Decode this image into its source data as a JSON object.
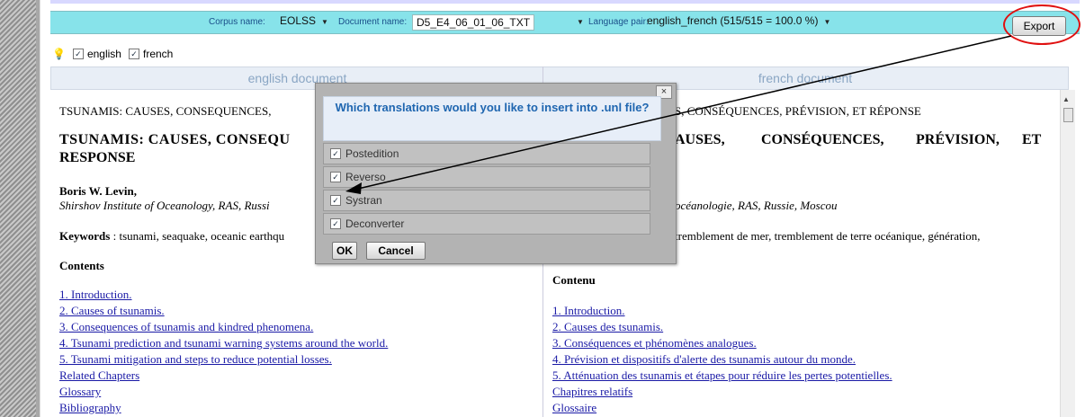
{
  "toolbar": {
    "corpus_label": "Corpus name:",
    "corpus_value": "EOLSS",
    "document_label": "Document name:",
    "document_value": "D5_E4_06_01_06_TXT",
    "language_label": "Language pair:",
    "language_value": "english_french (515/515 = 100.0 %)",
    "export_label": "Export"
  },
  "languages": {
    "english": "english",
    "french": "french"
  },
  "columns": {
    "left_header": "english document",
    "right_header": "french document"
  },
  "english_doc": {
    "title_line": "TSUNAMIS: CAUSES, CONSEQUENCES,",
    "heading_1": "TSUNAMIS: CAUSES, CONSEQU",
    "heading_2": "RESPONSE",
    "author": "Boris W. Levin,",
    "affiliation": "Shirshov Institute of Oceanology, RAS, Russi",
    "keywords_label": "Keywords",
    "keywords_text": ": tsunami, seaquake, oceanic earthqu",
    "contents_heading": "Contents",
    "toc": [
      "1. Introduction.",
      "2. Causes of tsunamis.",
      "3. Consequences of tsunamis and kindred phenomena.",
      "4. Tsunami prediction and tsunami warning systems around the world.",
      "5. Tsunami mitigation and steps to reduce potential losses.",
      "Related Chapters",
      "Glossary",
      "Bibliography"
    ]
  },
  "french_doc": {
    "title_line": "S, CONSÉQUENCES, PRÉVISION, ET RÉPONSE",
    "heading_1": "AUSES,",
    "heading_1b": "CONSÉQUENCES,",
    "heading_1c": "PRÉVISION,",
    "heading_1d": "ET",
    "affiliation": "océanologie, RAS, Russie, Moscou",
    "keywords_text": "tremblement de mer, tremblement de terre océanique, génération,",
    "contents_heading": "Contenu",
    "toc": [
      "1. Introduction.",
      "2. Causes des tsunamis.",
      "3. Conséquences et phénomènes analogues.",
      "4. Prévision et dispositifs d'alerte des tsunamis autour du monde.",
      "5. Atténuation des tsunamis et étapes pour réduire les pertes potentielles.",
      "Chapitres relatifs",
      "Glossaire"
    ]
  },
  "dialog": {
    "title": "Which translations would you like to insert into .unl file?",
    "close_label": "×",
    "options": [
      {
        "label": "Postedition",
        "checked": true
      },
      {
        "label": "Reverso",
        "checked": true
      },
      {
        "label": "Systran",
        "checked": true
      },
      {
        "label": "Deconverter",
        "checked": true
      }
    ],
    "ok_label": "OK",
    "cancel_label": "Cancel"
  },
  "colors": {
    "toolbar_bg": "#87e3ea",
    "header_text": "#8aa6c4",
    "dialog_title": "#1f66b0",
    "link": "#1a1aa6",
    "annotation": "#e01010"
  }
}
